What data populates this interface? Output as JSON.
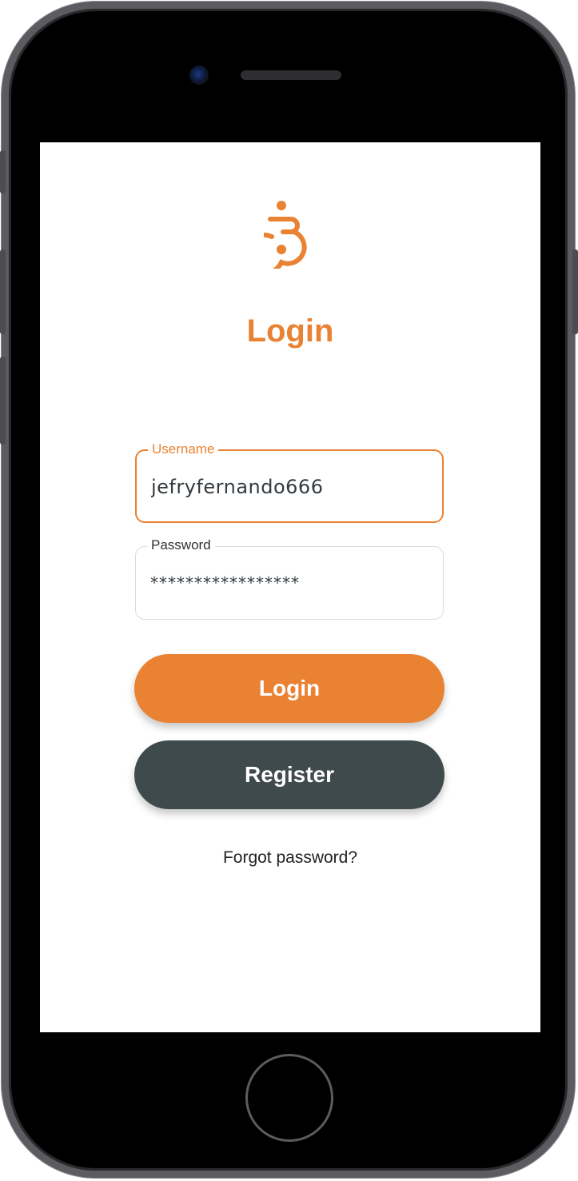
{
  "app": {
    "logo_icon": "wheelchair-logo-icon",
    "title": "Login"
  },
  "form": {
    "username": {
      "label": "Username",
      "value": "jefryfernando666"
    },
    "password": {
      "label": "Password",
      "value": "*****************"
    }
  },
  "actions": {
    "login_label": "Login",
    "register_label": "Register",
    "forgot_label": "Forgot password?"
  },
  "colors": {
    "accent": "#e98233",
    "secondary": "#3f4a4d",
    "device_frame": "#5b5b60"
  }
}
